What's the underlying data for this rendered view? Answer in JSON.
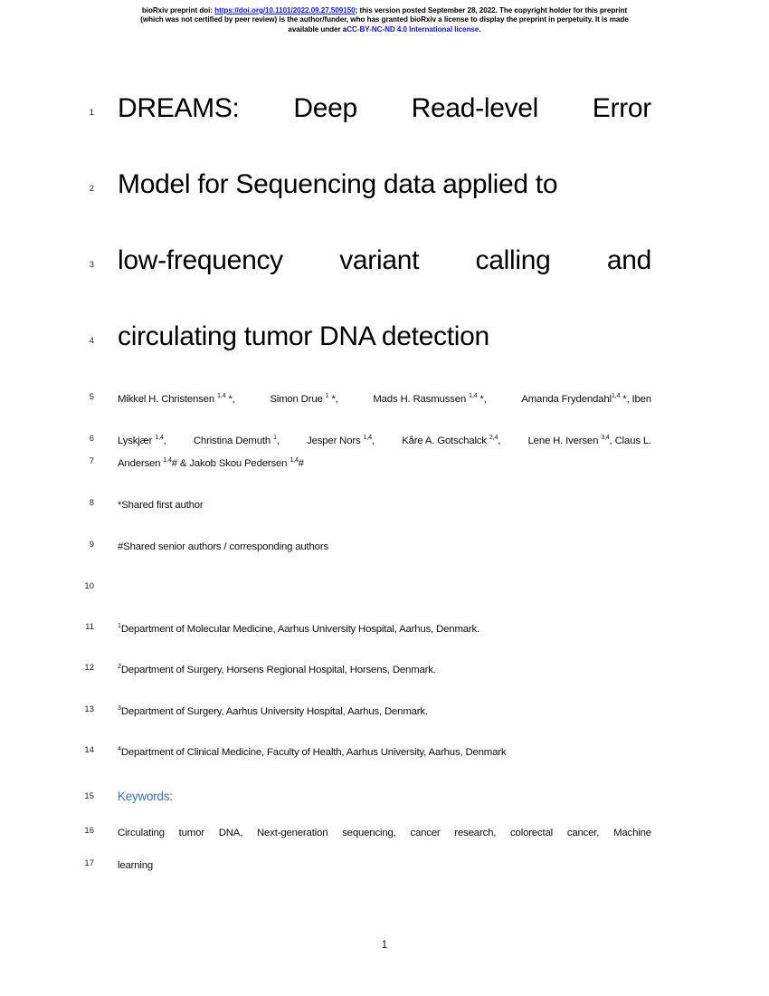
{
  "banner": {
    "prefix": "bioRxiv preprint doi: ",
    "doi_link": "https://doi.org/10.1101/2022.09.27.509150",
    "middle": "; this version posted September 28, 2022. The copyright holder for this preprint",
    "line2": "(which was not certified by peer review) is the author/funder, who has granted bioRxiv a license to display the preprint in perpetuity. It is made",
    "line3_prefix": "available under a",
    "license_link": "CC-BY-NC-ND 4.0 International license",
    "line3_suffix": ".",
    "link_color": "#1414e6"
  },
  "title": {
    "line1": [
      "DREAMS:",
      "Deep",
      "Read-level",
      "Error"
    ],
    "line2": [
      "Model for Sequencing data applied to"
    ],
    "line3": [
      "low-frequency",
      "variant",
      "calling",
      "and"
    ],
    "line4": [
      "circulating tumor DNA detection"
    ]
  },
  "line_numbers": [
    "1",
    "2",
    "3",
    "4",
    "5",
    "6",
    "7",
    "8",
    "9",
    "10",
    "11",
    "12",
    "13",
    "14",
    "15",
    "16",
    "17"
  ],
  "authors": {
    "line1_segments": [
      {
        "text": "Mikkel H. Christensen ",
        "sup": "1,4",
        "after": " *, "
      },
      {
        "text": "Simon Drue ",
        "sup": "1",
        "after": " *, "
      },
      {
        "text": "Mads H. Rasmussen ",
        "sup": "1,4",
        "after": " *, "
      },
      {
        "text": "Amanda Frydendahl",
        "sup": "1,4",
        "after": " *, Iben"
      }
    ],
    "line2_segments": [
      {
        "text": "Lyskjær ",
        "sup": "1,4",
        "after": ", "
      },
      {
        "text": "Christina Demuth ",
        "sup": "1",
        "after": ", "
      },
      {
        "text": "Jesper Nors ",
        "sup": "1,4",
        "after": ", "
      },
      {
        "text": "Kåre A. Gotschalck ",
        "sup": "2,4",
        "after": ", "
      },
      {
        "text": "Lene H. Iversen ",
        "sup": "3,4",
        "after": ", Claus L."
      }
    ],
    "line3_segments": [
      {
        "text": "Andersen ",
        "sup": "1,4",
        "after": "# & "
      },
      {
        "text": "Jakob Skou Pedersen ",
        "sup": "1,4",
        "after": "#"
      }
    ],
    "shared_first": "*Shared first author",
    "shared_senior": "#Shared senior authors / corresponding authors",
    "blank": ""
  },
  "affiliations": [
    {
      "sup": "1",
      "text": "Department of Molecular Medicine, Aarhus University Hospital, Aarhus, Denmark."
    },
    {
      "sup": "2",
      "text": "Department of Surgery, Horsens Regional Hospital, Horsens, Denmark."
    },
    {
      "sup": "3",
      "text": "Department of Surgery, Aarhus University Hospital, Aarhus, Denmark."
    },
    {
      "sup": "4",
      "text": "Department of Clinical Medicine, Faculty of Health, Aarhus University, Aarhus, Denmark"
    }
  ],
  "keywords": {
    "heading": "Keywords:",
    "line1_words": [
      "Circulating",
      "tumor",
      "DNA,",
      "Next-generation",
      "sequencing,",
      "cancer",
      "research,",
      "colorectal",
      "cancer,",
      "Machine"
    ],
    "line2": "learning",
    "heading_color": "#3c6eb4"
  },
  "footer": {
    "page_number": "1"
  }
}
